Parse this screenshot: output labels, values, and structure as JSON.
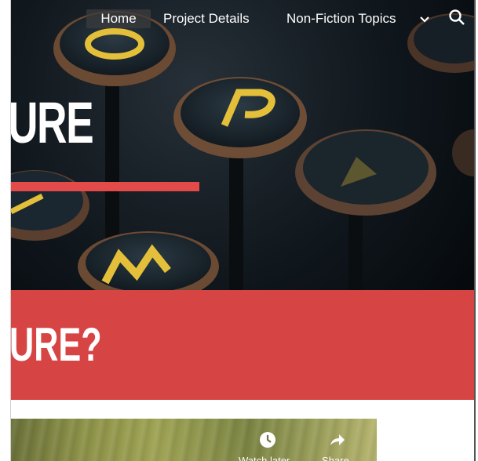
{
  "nav": {
    "items": [
      {
        "label": "Home",
        "active": true
      },
      {
        "label": "Project Details"
      },
      {
        "label": "Non-Fiction Topics"
      }
    ],
    "more_icon": "chevron-down-icon",
    "search_icon": "search-icon"
  },
  "hero": {
    "title": "URE"
  },
  "banner": {
    "title": "URE?"
  },
  "video": {
    "watch_later_label": "Watch later",
    "share_label": "Share",
    "clock_icon": "clock-icon",
    "share_icon": "share-icon"
  },
  "colors": {
    "accent_red": "#d74444",
    "bar_red": "#e34b4b"
  }
}
